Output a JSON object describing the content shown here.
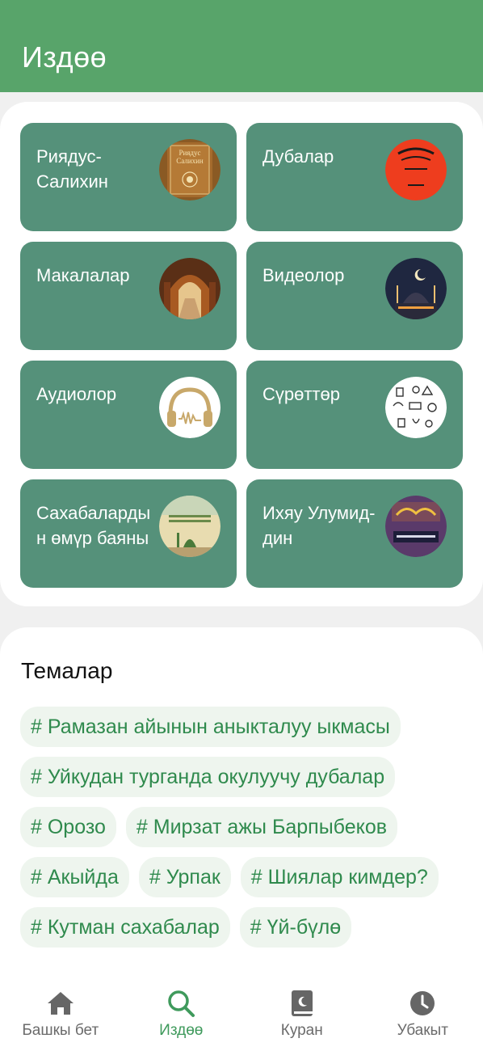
{
  "header": {
    "title": "Издөө"
  },
  "categories": [
    {
      "label": "Риядус-Салихин",
      "thumb": "book-cover-riyadus-salihin"
    },
    {
      "label": "Дубалар",
      "thumb": "book-cover-dubalar"
    },
    {
      "label": "Макалалар",
      "thumb": "library-photo"
    },
    {
      "label": "Видеолор",
      "thumb": "mosque-night-photo"
    },
    {
      "label": "Аудиолор",
      "thumb": "headphones-icon"
    },
    {
      "label": "Сүрөттөр",
      "thumb": "illustrations-pattern"
    },
    {
      "label": "Сахабалардын өмүр баяны",
      "thumb": "book-cover-sahabalar"
    },
    {
      "label": "Ихяу Улумид-дин",
      "thumb": "book-cover-ihyau"
    }
  ],
  "topics": {
    "title": "Темалар",
    "tags": [
      "# Рамазан айынын аныкталуу ыкмасы",
      "# Уйкудан турганда окулуучу дубалар",
      "# Орозо",
      "# Мирзат ажы Барпыбеков",
      "# Акыйда",
      "# Урпак",
      "# Шиялар кимдер?",
      "# Кутман сахабалар",
      "# Үй-бүлө"
    ]
  },
  "bottom_nav": [
    {
      "label": "Башкы бет",
      "icon": "home-icon",
      "active": false
    },
    {
      "label": "Издөө",
      "icon": "search-icon",
      "active": true
    },
    {
      "label": "Куран",
      "icon": "quran-book-icon",
      "active": false
    },
    {
      "label": "Убакыт",
      "icon": "clock-icon",
      "active": false
    }
  ],
  "colors": {
    "header_green": "#58a46a",
    "card_teal": "#55917a",
    "tag_text": "#2f8a4d",
    "tag_bg": "#eef5ee",
    "nav_active": "#3f9a5c"
  }
}
